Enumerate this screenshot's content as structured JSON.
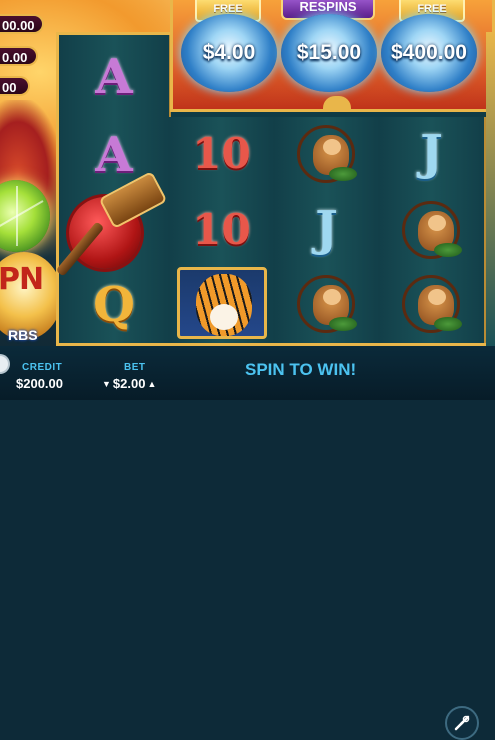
{
  "jackpots": [
    {
      "label": "00.00"
    },
    {
      "label": "0.00"
    },
    {
      "label": "00"
    }
  ],
  "logo": {
    "main": "PN",
    "sub": "RBS"
  },
  "respins": {
    "badges": [
      "FREE",
      "RESPINS",
      "FREE"
    ],
    "prizes": [
      "$4.00",
      "$15.00",
      "$400.00"
    ]
  },
  "reels": {
    "reel0": [
      "A",
      "A",
      "hammer",
      "Q"
    ],
    "reel1": [
      "10",
      "10",
      "tiger"
    ],
    "reel2": [
      "monkey",
      "J",
      "monkey"
    ],
    "reel3": [
      "J",
      "monkey",
      "monkey"
    ]
  },
  "bottom": {
    "credit_label": "CREDIT",
    "credit_value": "$200.00",
    "bet_label": "BET",
    "bet_value": "$2.00",
    "bet_down": "▼",
    "bet_up": "▲",
    "message": "SPIN TO WIN!"
  },
  "icons": [
    "hammer-icon",
    "tiger-icon",
    "monkey-icon",
    "tools-icon"
  ],
  "colors": {
    "gold": "#e9b64a",
    "accent_blue": "#4cc3f0",
    "reel_bg": "#1a5258"
  }
}
